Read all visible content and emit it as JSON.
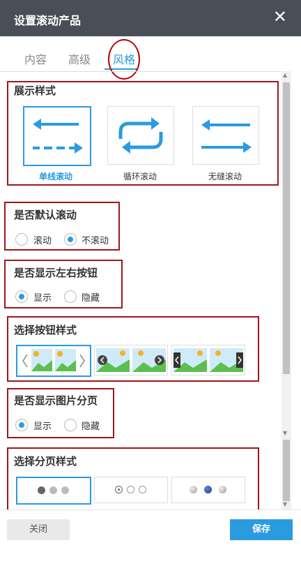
{
  "dialog": {
    "title": "设置滚动产品",
    "close_icon": "close-icon"
  },
  "tabs": [
    {
      "label": "内容",
      "active": false
    },
    {
      "label": "高级",
      "active": false
    },
    {
      "label": "风格",
      "active": true
    }
  ],
  "display_style": {
    "title": "展示样式",
    "options": [
      {
        "label": "单线滚动",
        "icon": "single-line-scroll-icon",
        "selected": true
      },
      {
        "label": "循环滚动",
        "icon": "loop-scroll-icon",
        "selected": false
      },
      {
        "label": "无缝滚动",
        "icon": "seamless-scroll-icon",
        "selected": false
      }
    ]
  },
  "default_scroll": {
    "title": "是否默认滚动",
    "options": [
      {
        "label": "滚动",
        "checked": false
      },
      {
        "label": "不滚动",
        "checked": true
      }
    ]
  },
  "show_lr_buttons": {
    "title": "是否显示左右按钮",
    "options": [
      {
        "label": "显示",
        "checked": true
      },
      {
        "label": "隐藏",
        "checked": false
      }
    ]
  },
  "button_style": {
    "title": "选择按钮样式",
    "options": [
      {
        "style": "chevron-outline",
        "selected": true
      },
      {
        "style": "round-dark",
        "selected": false
      },
      {
        "style": "square-dark",
        "selected": false
      }
    ]
  },
  "show_pagination": {
    "title": "是否显示图片分页",
    "options": [
      {
        "label": "显示",
        "checked": true
      },
      {
        "label": "隐藏",
        "checked": false
      }
    ]
  },
  "pagination_style": {
    "title": "选择分页样式",
    "options": [
      {
        "style": "filled-gray-dots",
        "selected": true
      },
      {
        "style": "ring-dots",
        "selected": false
      },
      {
        "style": "gradient-dots-blue",
        "selected": false
      }
    ]
  },
  "footer": {
    "close_label": "关闭",
    "save_label": "保存"
  },
  "colors": {
    "accent": "#2a9be0",
    "titlebar": "#4a4e57",
    "highlight_box": "#a0161c"
  }
}
